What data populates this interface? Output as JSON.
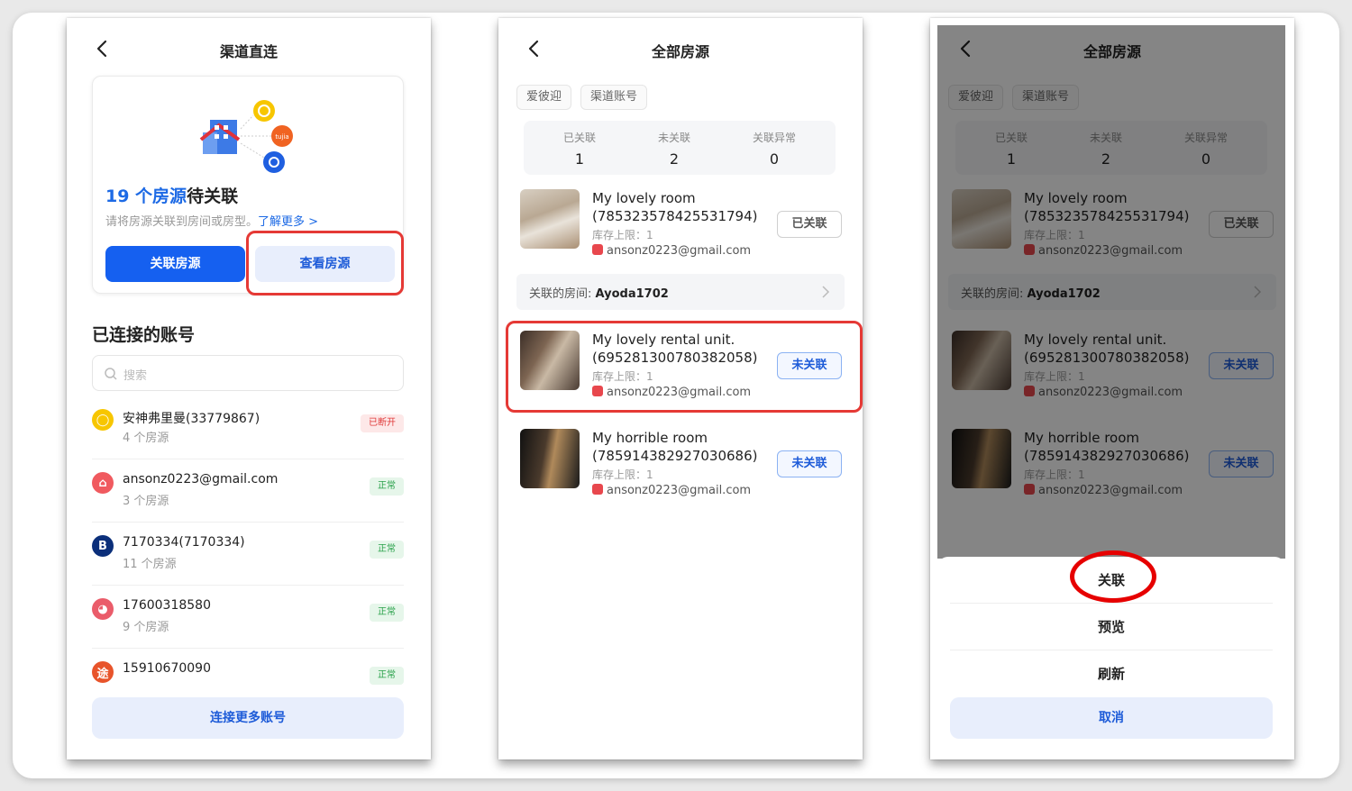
{
  "colors": {
    "primary": "#1560f0",
    "accent_text": "#1d5bd8",
    "highlight": "#e53935",
    "status_ok": "#27a048",
    "status_off": "#e03a3a"
  },
  "screen1": {
    "title": "渠道直连",
    "pending_count": "19 个房源",
    "pending_suffix": "待关联",
    "description": "请将房源关联到房间或房型。",
    "learn_more": "了解更多 >",
    "link_button": "关联房源",
    "view_button": "查看房源",
    "section_title": "已连接的账号",
    "search_placeholder": "搜索",
    "accounts": [
      {
        "name": "安神弗里曼(33779867)",
        "count": "4 个房源",
        "status": "已断开",
        "icon": "aibiying-icon"
      },
      {
        "name": "ansonz0223@gmail.com",
        "count": "3 个房源",
        "status": "正常",
        "icon": "airbnb-icon"
      },
      {
        "name": "7170334(7170334)",
        "count": "11 个房源",
        "status": "正常",
        "icon": "booking-icon"
      },
      {
        "name": "17600318580",
        "count": "9 个房源",
        "status": "正常",
        "icon": "xiaozhu-icon"
      },
      {
        "name": "15910670090",
        "count": "",
        "status": "正常",
        "icon": "tujia-icon"
      }
    ],
    "connect_more": "连接更多账号"
  },
  "screen2": {
    "title": "全部房源",
    "chips": [
      "爱彼迎",
      "渠道账号"
    ],
    "stats": [
      {
        "label": "已关联",
        "value": "1"
      },
      {
        "label": "未关联",
        "value": "2"
      },
      {
        "label": "关联异常",
        "value": "0"
      }
    ],
    "rooms": [
      {
        "title": "My lovely room (785323578425531794)",
        "stock": "库存上限：1",
        "account": "ansonz0223@gmail.com",
        "button": "已关联"
      },
      {
        "title": "My lovely rental unit. (695281300780382058)",
        "stock": "库存上限：1",
        "account": "ansonz0223@gmail.com",
        "button": "未关联"
      },
      {
        "title": "My horrible room (785914382927030686)",
        "stock": "库存上限：1",
        "account": "ansonz0223@gmail.com",
        "button": "未关联"
      }
    ],
    "linked_room_label": "关联的房间:",
    "linked_room_value": "Ayoda1702"
  },
  "screen3": {
    "sheet": [
      "关联",
      "预览",
      "刷新"
    ],
    "cancel": "取消"
  }
}
